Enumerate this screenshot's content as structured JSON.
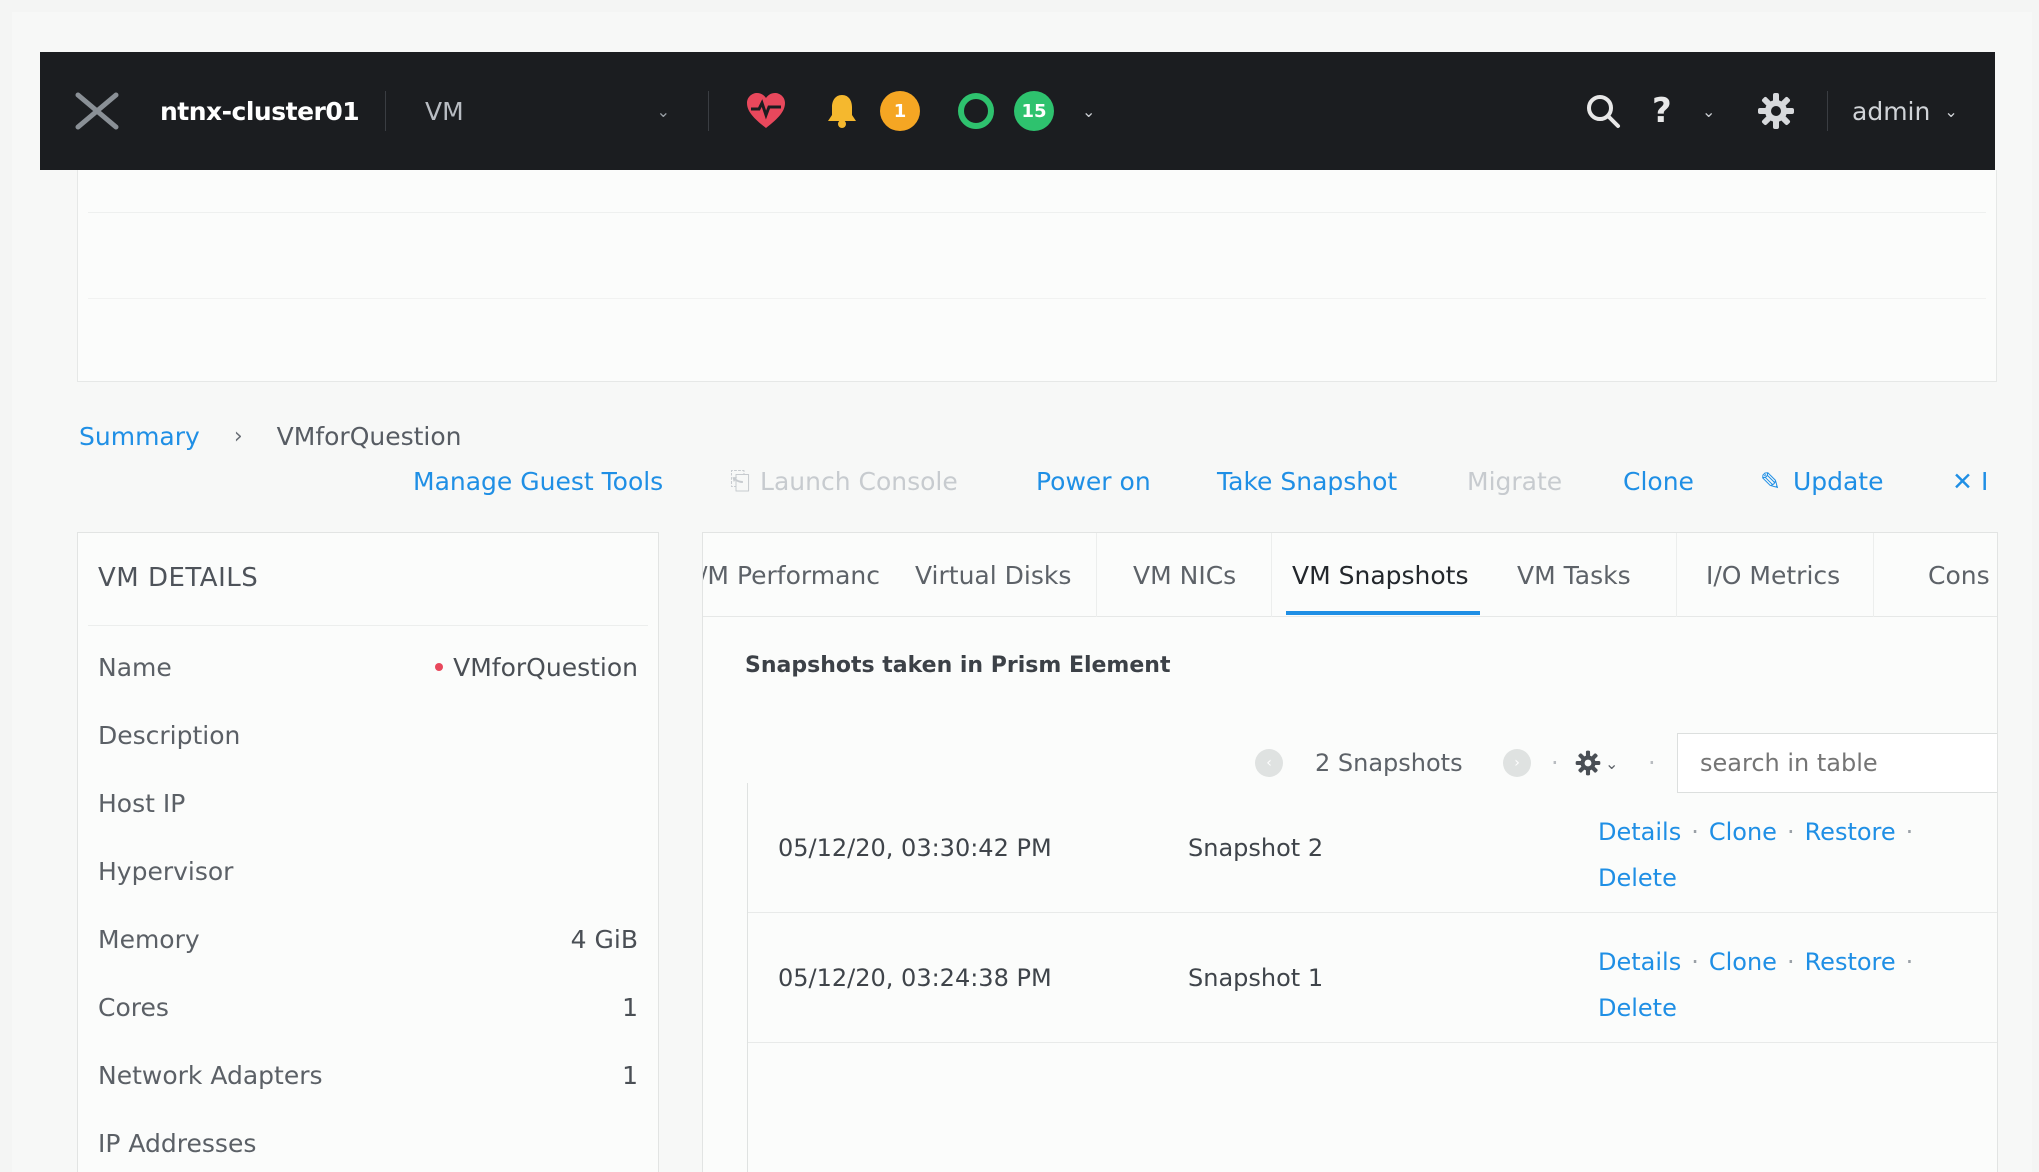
{
  "header": {
    "cluster_name": "ntnx-cluster01",
    "view_selector": "VM",
    "alert_warning_count": "1",
    "task_count": "15",
    "user": "admin",
    "help_label": "?",
    "icons": [
      "nutanix-logo-icon",
      "health-heart-icon",
      "bell-icon",
      "ring-icon",
      "search-icon",
      "gear-icon"
    ],
    "colors": {
      "warning": "#f5a623",
      "ok": "#2ec26e",
      "alert": "#e8485c",
      "accent": "#1f8fe5"
    }
  },
  "breadcrumb": {
    "parent": "Summary",
    "current": "VMforQuestion"
  },
  "actions": {
    "manage_guest_tools": "Manage Guest Tools",
    "launch_console": "Launch Console",
    "power_on": "Power on",
    "take_snapshot": "Take Snapshot",
    "migrate": "Migrate",
    "clone": "Clone",
    "update": "Update",
    "delete_partial": "I"
  },
  "vm_details": {
    "title": "VM DETAILS",
    "rows": [
      {
        "label": "Name",
        "value": "VMforQuestion"
      },
      {
        "label": "Description",
        "value": ""
      },
      {
        "label": "Host IP",
        "value": ""
      },
      {
        "label": "Hypervisor",
        "value": ""
      },
      {
        "label": "Memory",
        "value": "4 GiB"
      },
      {
        "label": "Cores",
        "value": "1"
      },
      {
        "label": "Network Adapters",
        "value": "1"
      },
      {
        "label": "IP Addresses",
        "value": ""
      }
    ]
  },
  "tabs": {
    "items": [
      "/M Performanc",
      "Virtual Disks",
      "VM NICs",
      "VM Snapshots",
      "VM Tasks",
      "I/O Metrics",
      "Cons"
    ],
    "active": "VM Snapshots"
  },
  "snapshots": {
    "section_title": "Snapshots taken in Prism Element",
    "count_label": "2 Snapshots",
    "search_placeholder": "search in table",
    "rows": [
      {
        "time": "05/12/20, 03:30:42 PM",
        "name": "Snapshot 2",
        "a_details": "Details",
        "a_clone": "Clone",
        "a_restore": "Restore",
        "a_delete": "Delete"
      },
      {
        "time": "05/12/20, 03:24:38 PM",
        "name": "Snapshot 1",
        "a_details": "Details",
        "a_clone": "Clone",
        "a_restore": "Restore",
        "a_delete": "Delete"
      }
    ]
  }
}
